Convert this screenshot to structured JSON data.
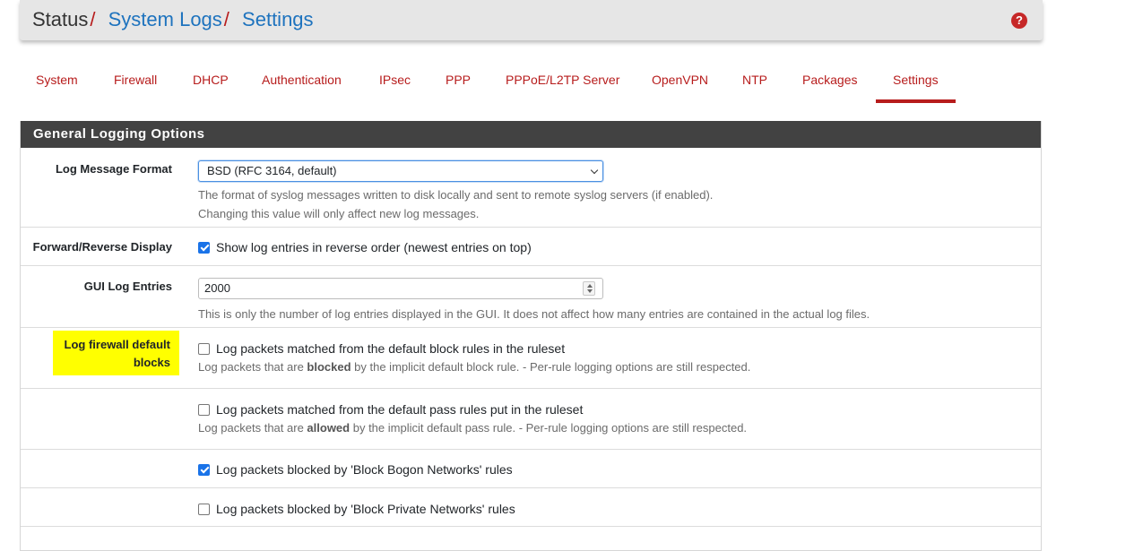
{
  "breadcrumb": {
    "root": "Status",
    "separator": "/",
    "level2": "System Logs",
    "level3": "Settings"
  },
  "help_icon": "question-circle-icon",
  "tabs": [
    {
      "label": "System"
    },
    {
      "label": "Firewall"
    },
    {
      "label": "DHCP"
    },
    {
      "label": "Authentication"
    },
    {
      "label": "IPsec"
    },
    {
      "label": "PPP"
    },
    {
      "label": "PPPoE/L2TP Server"
    },
    {
      "label": "OpenVPN"
    },
    {
      "label": "NTP"
    },
    {
      "label": "Packages"
    },
    {
      "label": "Settings",
      "active": true
    }
  ],
  "panel": {
    "title": "General Logging Options",
    "log_format": {
      "label": "Log Message Format",
      "value": "BSD (RFC 3164, default)",
      "help1": "The format of syslog messages written to disk locally and sent to remote syslog servers (if enabled).",
      "help2": "Changing this value will only affect new log messages."
    },
    "reverse_display": {
      "label": "Forward/Reverse Display",
      "checkbox_label": "Show log entries in reverse order (newest entries on top)",
      "checked": true
    },
    "gui_log_entries": {
      "label": "GUI Log Entries",
      "value": "2000",
      "help": "This is only the number of log entries displayed in the GUI. It does not affect how many entries are contained in the actual log files."
    },
    "default_blocks": {
      "label": "Log firewall default blocks",
      "block_rules": {
        "checkbox_label": "Log packets matched from the default block rules in the ruleset",
        "checked": false,
        "help_pre": "Log packets that are ",
        "help_bold": "blocked",
        "help_post": " by the implicit default block rule. - Per-rule logging options are still respected."
      },
      "pass_rules": {
        "checkbox_label": "Log packets matched from the default pass rules put in the ruleset",
        "checked": false,
        "help_pre": "Log packets that are ",
        "help_bold": "allowed",
        "help_post": " by the implicit default pass rule. - Per-rule logging options are still respected."
      },
      "bogon": {
        "checkbox_label": "Log packets blocked by 'Block Bogon Networks' rules",
        "checked": true
      },
      "private": {
        "checkbox_label": "Log packets blocked by 'Block Private Networks' rules",
        "checked": false
      }
    }
  },
  "colors": {
    "accent_red": "#b71c1c",
    "link_blue": "#1e73be",
    "panel_header_bg": "#424242",
    "highlight_yellow": "#ffff00",
    "checkbox_blue": "#1a73e8"
  }
}
